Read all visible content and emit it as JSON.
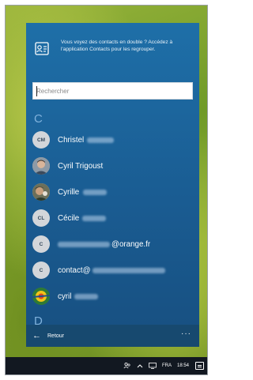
{
  "notice": {
    "text": "Vous voyez des contacts en double ? Accédez à l'application Contacts pour les regrouper.",
    "icon": "contacts-merge-icon"
  },
  "search": {
    "placeholder": "Rechercher",
    "value": ""
  },
  "groups": [
    {
      "letter": "C"
    },
    {
      "letter": "D"
    }
  ],
  "contacts": [
    {
      "initials": "CM",
      "name": "Christel",
      "avatar_type": "initials"
    },
    {
      "initials": "",
      "name": "Cyril Trigoust",
      "avatar_type": "photo"
    },
    {
      "initials": "",
      "name": "Cyrille",
      "avatar_type": "photo"
    },
    {
      "initials": "CL",
      "name": "Cécile",
      "avatar_type": "initials"
    },
    {
      "initials": "C",
      "name": "@orange.fr",
      "avatar_type": "initials"
    },
    {
      "initials": "C",
      "name": "contact@",
      "avatar_type": "initials"
    },
    {
      "initials": "",
      "name": "cyril",
      "avatar_type": "photo"
    }
  ],
  "bottom_bar": {
    "back_label": "Retour",
    "more_label": "···"
  },
  "taskbar": {
    "language": "FRA",
    "time": "18:54"
  },
  "colors": {
    "panel": "#1a5c92",
    "bottom_bar": "#17496f",
    "taskbar": "#121821",
    "group_letter": "#7fb1dc"
  }
}
